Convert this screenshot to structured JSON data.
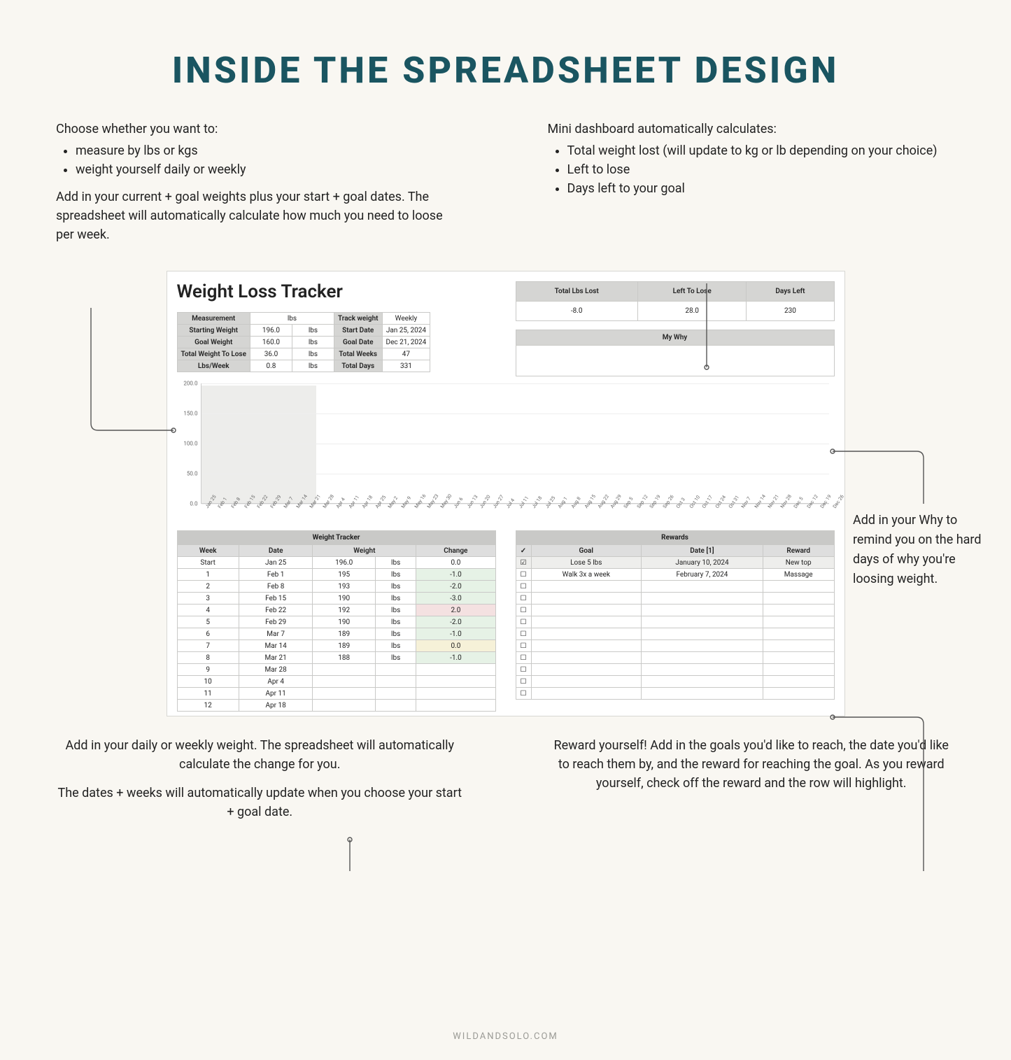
{
  "title": "INSIDE THE SPREADSHEET DESIGN",
  "footer": "WILDANDSOLO.COM",
  "callout_top_left": {
    "intro": "Choose whether you want to:",
    "bullets": [
      "measure by lbs or kgs",
      "weight yourself daily or weekly"
    ],
    "para": "Add in your current + goal weights plus your start + goal dates. The spreadsheet will automatically calculate how much you need to loose per week."
  },
  "callout_top_right": {
    "intro": "Mini dashboard automatically calculates:",
    "bullets": [
      "Total weight lost (will update to kg or lb depending on your choice)",
      "Left to lose",
      "Days left to your goal"
    ]
  },
  "callout_side": "Add in your Why to remind you on the hard days of why you're loosing weight.",
  "callout_bottom_left": {
    "p1": "Add in your daily or weekly weight. The spreadsheet will automatically calculate the change for you.",
    "p2": "The dates + weeks will automatically update when you choose your start + goal date."
  },
  "callout_bottom_right": "Reward yourself! Add in the goals you'd like to reach, the date you'd like to reach them by, and the reward for reaching the goal. As you reward yourself, check off the reward and the row will highlight.",
  "sheet": {
    "title": "Weight Loss Tracker",
    "settings_labels": {
      "measurement": "Measurement",
      "lbs": "lbs",
      "track": "Track weight",
      "weekly": "Weekly",
      "starting": "Starting Weight",
      "starting_val": "196.0",
      "unit": "lbs",
      "startdate_lbl": "Start Date",
      "startdate": "Jan 25, 2024",
      "goalw": "Goal Weight",
      "goalw_val": "160.0",
      "goaldate_lbl": "Goal Date",
      "goaldate": "Dec 21, 2024",
      "tolose": "Total Weight To Lose",
      "tolose_val": "36.0",
      "totalweeks_lbl": "Total Weeks",
      "totalweeks": "47",
      "perweek": "Lbs/Week",
      "perweek_val": "0.8",
      "totaldays_lbl": "Total Days",
      "totaldays": "331"
    },
    "dashboard": {
      "h1": "Total Lbs Lost",
      "h2": "Left To Lose",
      "h3": "Days Left",
      "v1": "-8.0",
      "v2": "28.0",
      "v3": "230"
    },
    "mywhy_title": "My Why",
    "tracker_title": "Weight Tracker",
    "tracker_headers": {
      "week": "Week",
      "date": "Date",
      "weight": "Weight",
      "change": "Change"
    },
    "tracker_rows": [
      {
        "week": "Start",
        "date": "Jan 25",
        "w": "196.0",
        "u": "lbs",
        "chg": "0.0",
        "cls": ""
      },
      {
        "week": "1",
        "date": "Feb 1",
        "w": "195",
        "u": "lbs",
        "chg": "-1.0",
        "cls": "chg-green"
      },
      {
        "week": "2",
        "date": "Feb 8",
        "w": "193",
        "u": "lbs",
        "chg": "-2.0",
        "cls": "chg-green"
      },
      {
        "week": "3",
        "date": "Feb 15",
        "w": "190",
        "u": "lbs",
        "chg": "-3.0",
        "cls": "chg-green"
      },
      {
        "week": "4",
        "date": "Feb 22",
        "w": "192",
        "u": "lbs",
        "chg": "2.0",
        "cls": "chg-red"
      },
      {
        "week": "5",
        "date": "Feb 29",
        "w": "190",
        "u": "lbs",
        "chg": "-2.0",
        "cls": "chg-green"
      },
      {
        "week": "6",
        "date": "Mar 7",
        "w": "189",
        "u": "lbs",
        "chg": "-1.0",
        "cls": "chg-green"
      },
      {
        "week": "7",
        "date": "Mar 14",
        "w": "189",
        "u": "lbs",
        "chg": "0.0",
        "cls": "chg-yellow"
      },
      {
        "week": "8",
        "date": "Mar 21",
        "w": "188",
        "u": "lbs",
        "chg": "-1.0",
        "cls": "chg-green"
      },
      {
        "week": "9",
        "date": "Mar 28",
        "w": "",
        "u": "",
        "chg": "",
        "cls": ""
      },
      {
        "week": "10",
        "date": "Apr 4",
        "w": "",
        "u": "",
        "chg": "",
        "cls": ""
      },
      {
        "week": "11",
        "date": "Apr 11",
        "w": "",
        "u": "",
        "chg": "",
        "cls": ""
      },
      {
        "week": "12",
        "date": "Apr 18",
        "w": "",
        "u": "",
        "chg": "",
        "cls": ""
      }
    ],
    "rewards_title": "Rewards",
    "rewards_headers": {
      "chk": "✓",
      "goal": "Goal",
      "date": "Date [1]",
      "reward": "Reward"
    },
    "rewards_rows": [
      {
        "done": true,
        "goal": "Lose 5 lbs",
        "date": "January 10, 2024",
        "reward": "New top"
      },
      {
        "done": false,
        "goal": "Walk 3x a week",
        "date": "February 7, 2024",
        "reward": "Massage"
      },
      {
        "done": false,
        "goal": "",
        "date": "",
        "reward": ""
      },
      {
        "done": false,
        "goal": "",
        "date": "",
        "reward": ""
      },
      {
        "done": false,
        "goal": "",
        "date": "",
        "reward": ""
      },
      {
        "done": false,
        "goal": "",
        "date": "",
        "reward": ""
      },
      {
        "done": false,
        "goal": "",
        "date": "",
        "reward": ""
      },
      {
        "done": false,
        "goal": "",
        "date": "",
        "reward": ""
      },
      {
        "done": false,
        "goal": "",
        "date": "",
        "reward": ""
      },
      {
        "done": false,
        "goal": "",
        "date": "",
        "reward": ""
      },
      {
        "done": false,
        "goal": "",
        "date": "",
        "reward": ""
      },
      {
        "done": false,
        "goal": "",
        "date": "",
        "reward": ""
      }
    ]
  },
  "chart_data": {
    "type": "area",
    "title": "",
    "xlabel": "",
    "ylabel": "",
    "ylim": [
      0,
      200
    ],
    "yticks": [
      0.0,
      50.0,
      100.0,
      150.0,
      200.0
    ],
    "x_categories": [
      "Jan 25",
      "Feb 1",
      "Feb 8",
      "Feb 15",
      "Feb 22",
      "Feb 29",
      "Mar 7",
      "Mar 14",
      "Mar 21",
      "Mar 28",
      "Apr 4",
      "Apr 11",
      "Apr 18",
      "Apr 25",
      "May 2",
      "May 9",
      "May 16",
      "May 23",
      "May 30",
      "Jun 6",
      "Jun 13",
      "Jun 20",
      "Jun 27",
      "Jul 4",
      "Jul 11",
      "Jul 18",
      "Jul 25",
      "Aug 1",
      "Aug 8",
      "Aug 15",
      "Aug 22",
      "Aug 29",
      "Sep 5",
      "Sep 12",
      "Sep 19",
      "Sep 26",
      "Oct 3",
      "Oct 10",
      "Oct 17",
      "Oct 24",
      "Oct 31",
      "Nov 7",
      "Nov 14",
      "Nov 21",
      "Nov 28",
      "Dec 5",
      "Dec 12",
      "Dec 19",
      "Dec 26"
    ],
    "series": [
      {
        "name": "Weight",
        "values": [
          196,
          195,
          193,
          190,
          192,
          190,
          189,
          189,
          188,
          null,
          null,
          null,
          null,
          null,
          null,
          null,
          null,
          null,
          null,
          null,
          null,
          null,
          null,
          null,
          null,
          null,
          null,
          null,
          null,
          null,
          null,
          null,
          null,
          null,
          null,
          null,
          null,
          null,
          null,
          null,
          null,
          null,
          null,
          null,
          null,
          null,
          null,
          null,
          null
        ]
      }
    ]
  }
}
